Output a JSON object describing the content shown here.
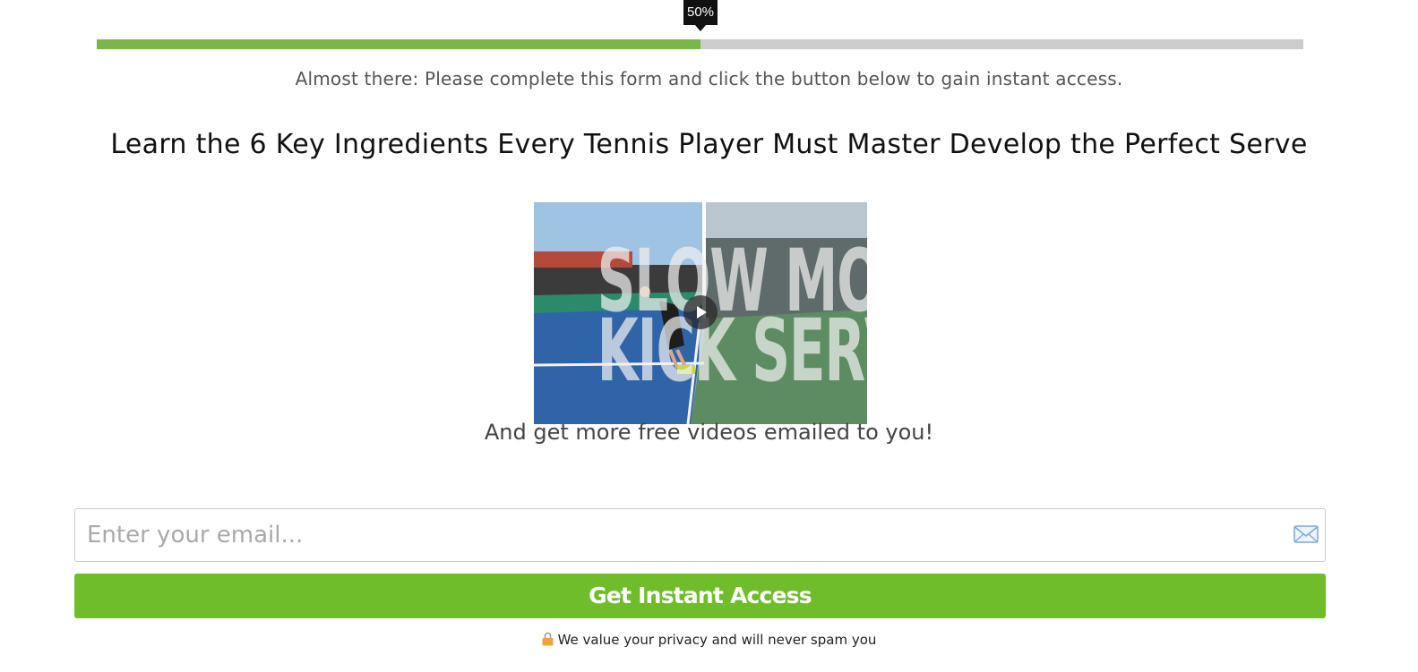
{
  "progress": {
    "label": "50%",
    "value": 0.5,
    "fill_color": "#7ab648",
    "track_color": "#cccccc"
  },
  "subtitle": "Almost there: Please complete this form and click the button below to gain instant access.",
  "headline": "Learn the 6 Key Ingredients Every Tennis Player Must Master Develop the Perfect Serve",
  "video": {
    "caption_line1": "SLOW MOTION",
    "caption_line2": "KICK SERVE",
    "play_icon": "play-icon"
  },
  "video_tagline": "And get more free videos emailed to you!",
  "email": {
    "placeholder": "Enter your email...",
    "value": "",
    "icon": "mail-icon"
  },
  "cta": {
    "label": "Get Instant Access",
    "color": "#6fbd2b"
  },
  "privacy": {
    "text": "We value your privacy and will never spam you",
    "icon": "lock-icon"
  }
}
